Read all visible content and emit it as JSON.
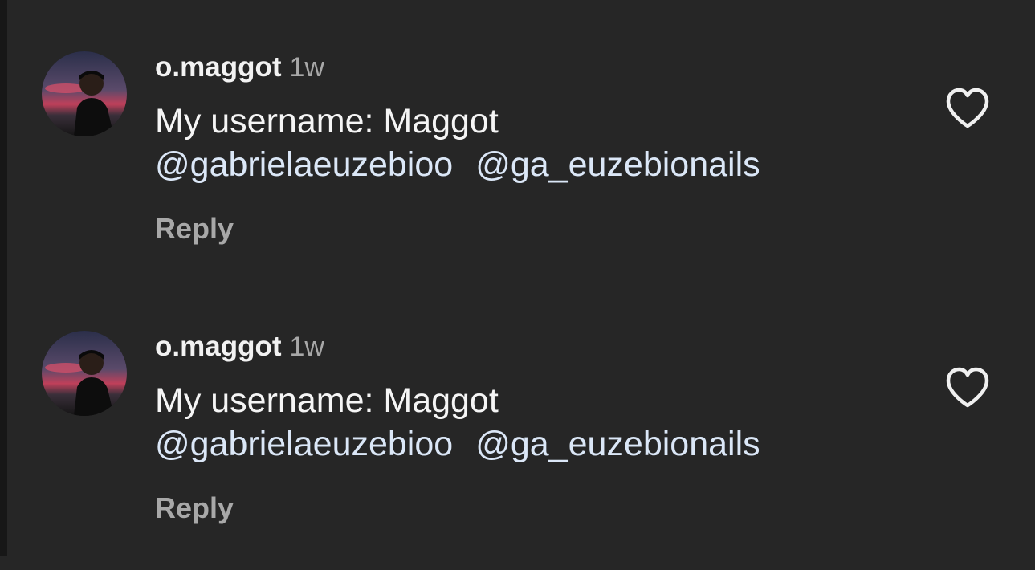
{
  "comments": [
    {
      "username": "o.maggot",
      "time": "1w",
      "text": "My username: Maggot",
      "mentions": [
        "@gabrielaeuzebioo",
        "@ga_euzebionails"
      ],
      "reply_label": "Reply",
      "like_icon": "heart-outline"
    },
    {
      "username": "o.maggot",
      "time": "1w",
      "text": "My username: Maggot",
      "mentions": [
        "@gabrielaeuzebioo",
        "@ga_euzebionails"
      ],
      "reply_label": "Reply",
      "like_icon": "heart-outline"
    }
  ],
  "colors": {
    "background": "#262626",
    "username": "#f2f2f2",
    "secondary_text": "#a8a8a8",
    "mention": "#dbe7f7"
  }
}
